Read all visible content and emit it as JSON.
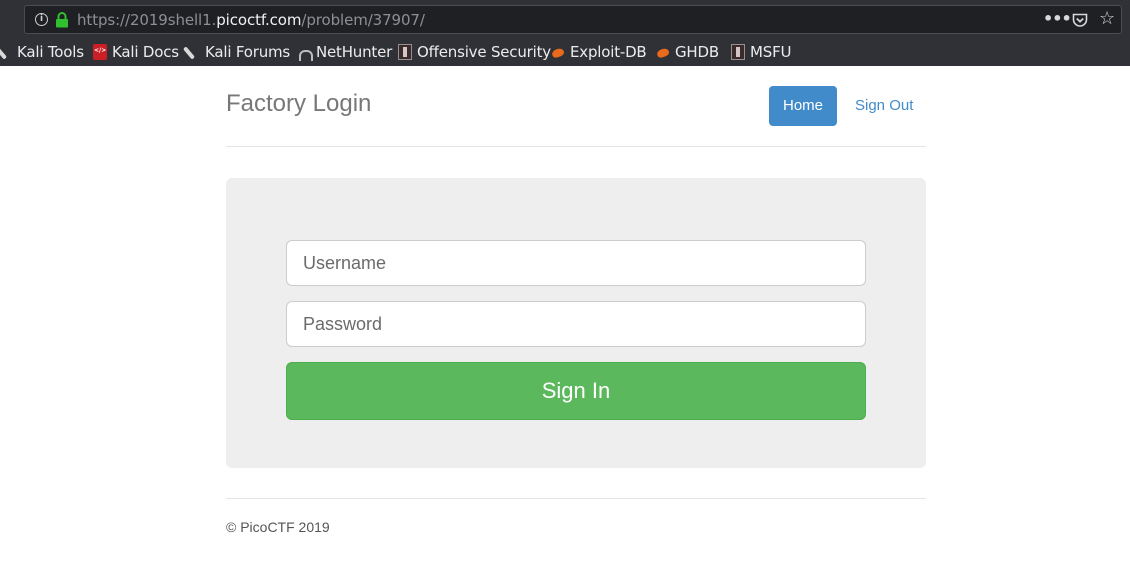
{
  "browser": {
    "url_prefix": "https://2019shell1.",
    "url_domain": "picoctf.com",
    "url_suffix": "/problem/37907/",
    "info_symbol": "i",
    "menu_symbol": "•••",
    "star_symbol": "☆",
    "bookmarks": [
      {
        "label": "Kali Tools",
        "icon": "kali-knife-icon"
      },
      {
        "label": "Kali Docs",
        "icon": "kali-docs-icon"
      },
      {
        "label": "Kali Forums",
        "icon": "kali-knife-icon"
      },
      {
        "label": "NetHunter",
        "icon": "nethunter-icon"
      },
      {
        "label": "Offensive Security",
        "icon": "offsec-icon"
      },
      {
        "label": "Exploit-DB",
        "icon": "exploitdb-icon"
      },
      {
        "label": "GHDB",
        "icon": "exploitdb-icon"
      },
      {
        "label": "MSFU",
        "icon": "offsec-icon"
      }
    ]
  },
  "header": {
    "title": "Factory Login",
    "home_label": "Home",
    "signout_label": "Sign Out"
  },
  "form": {
    "username_placeholder": "Username",
    "password_placeholder": "Password",
    "signin_label": "Sign In"
  },
  "footer": {
    "text": "© PicoCTF 2019"
  },
  "colors": {
    "primary": "#428bca",
    "success": "#5cb85c",
    "panel": "#eeeeee",
    "chrome": "#2f3137"
  }
}
